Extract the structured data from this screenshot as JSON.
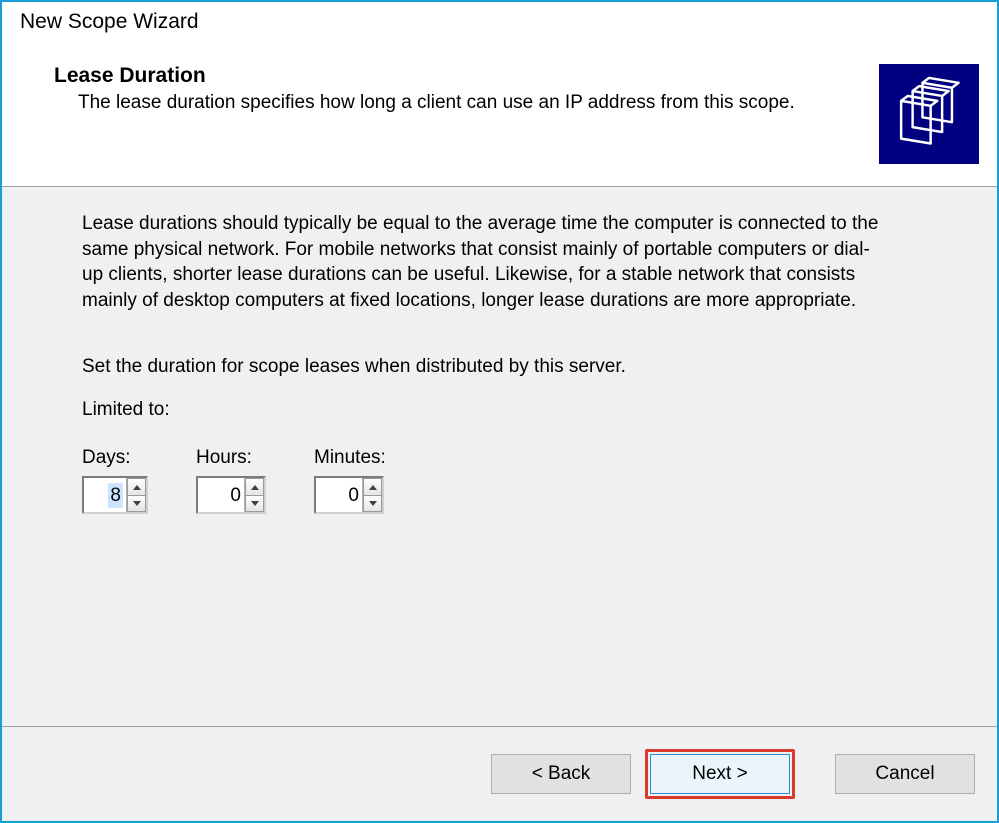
{
  "window": {
    "title": "New Scope Wizard"
  },
  "header": {
    "title": "Lease Duration",
    "subtitle": "The lease duration specifies how long a client can use an IP address from this scope.",
    "iconName": "folders-icon"
  },
  "body": {
    "paragraph1": "Lease durations should typically be equal to the average time the computer is connected to the same physical network. For mobile networks that consist mainly of portable computers or dial-up clients, shorter lease durations can be useful. Likewise, for a stable network that consists mainly of desktop computers at fixed locations, longer lease durations are more appropriate.",
    "paragraph2": "Set the duration for scope leases when distributed by this server.",
    "limitedLabel": "Limited to:",
    "days": {
      "label": "Days:",
      "value": "8"
    },
    "hours": {
      "label": "Hours:",
      "value": "0"
    },
    "minutes": {
      "label": "Minutes:",
      "value": "0"
    }
  },
  "footer": {
    "back": "< Back",
    "next": "Next >",
    "cancel": "Cancel"
  }
}
